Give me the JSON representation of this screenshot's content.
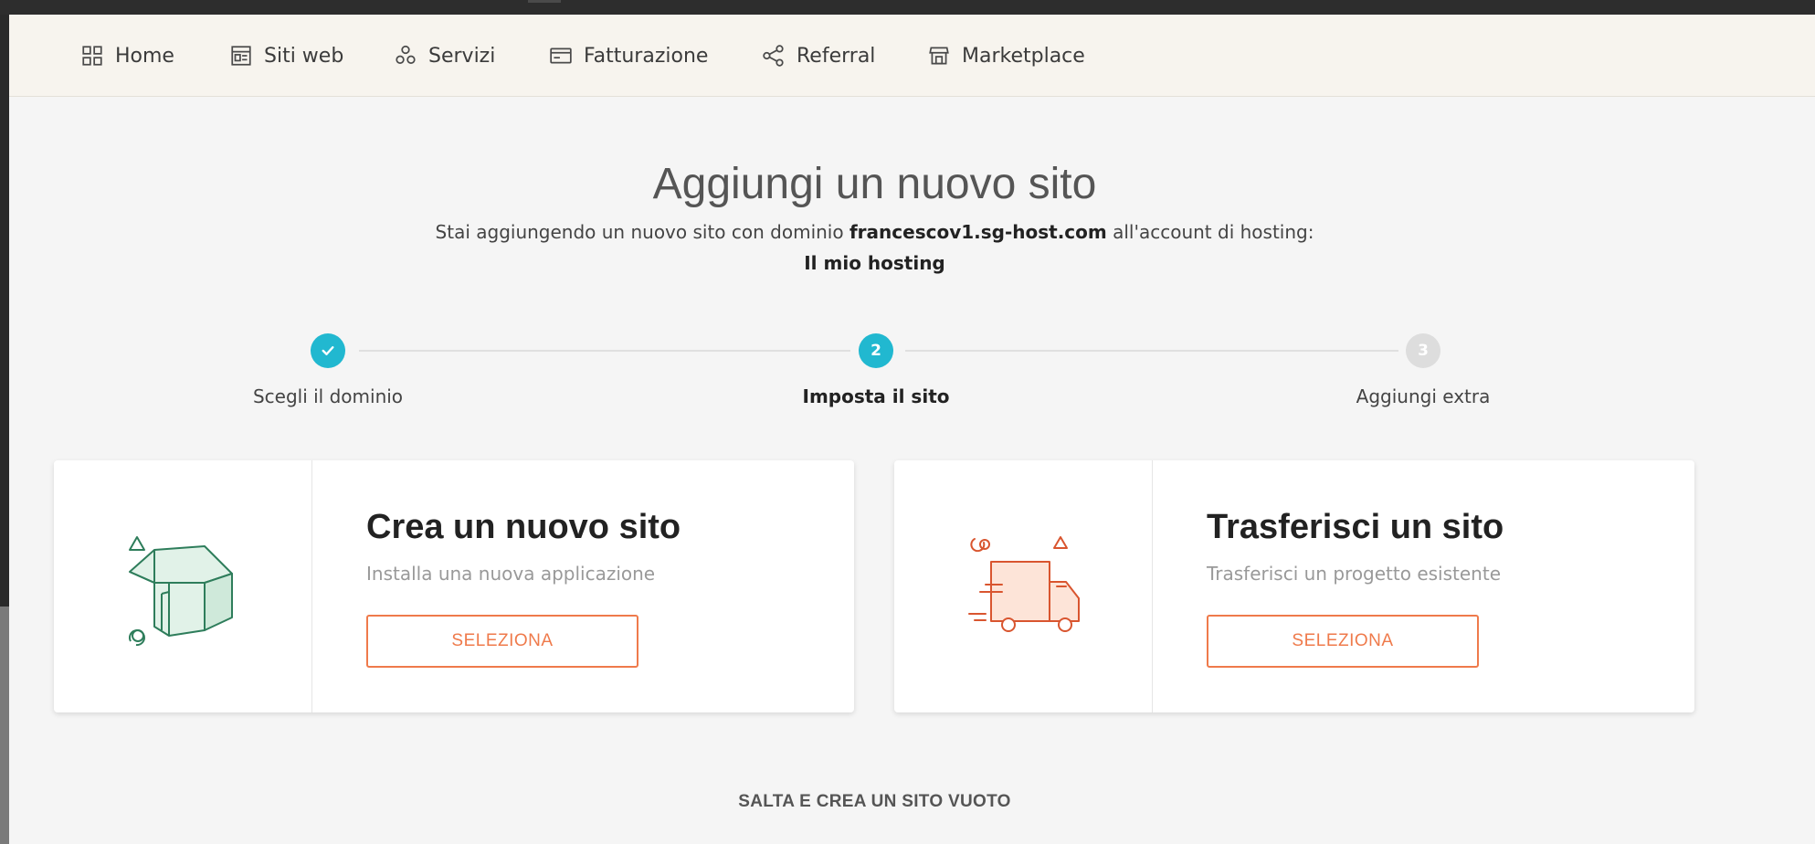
{
  "nav": {
    "items": [
      {
        "label": "Home",
        "icon": "grid-icon"
      },
      {
        "label": "Siti web",
        "icon": "website-icon"
      },
      {
        "label": "Servizi",
        "icon": "services-icon"
      },
      {
        "label": "Fatturazione",
        "icon": "billing-card-icon"
      },
      {
        "label": "Referral",
        "icon": "share-icon"
      },
      {
        "label": "Marketplace",
        "icon": "store-icon"
      }
    ]
  },
  "header": {
    "title": "Aggiungi un nuovo sito",
    "subtitle_prefix": "Stai aggiungendo un nuovo sito con dominio ",
    "domain": "francescov1.sg-host.com",
    "subtitle_suffix": " all'account di hosting:",
    "hosting_account": "Il mio hosting"
  },
  "stepper": {
    "steps": [
      {
        "number": "",
        "label": "Scegli il dominio",
        "state": "done"
      },
      {
        "number": "2",
        "label": "Imposta il sito",
        "state": "active"
      },
      {
        "number": "3",
        "label": "Aggiungi extra",
        "state": "pending"
      }
    ],
    "colors": {
      "done": "#21b8d0",
      "active": "#21b8d0",
      "pending": "#dddddd"
    }
  },
  "cards": [
    {
      "title": "Crea un nuovo sito",
      "description": "Installa una nuova applicazione",
      "button": "SELEZIONA",
      "icon": "house-box-icon"
    },
    {
      "title": "Trasferisci un sito",
      "description": "Trasferisci un progetto esistente",
      "button": "SELEZIONA",
      "icon": "delivery-truck-icon"
    }
  ],
  "skip": {
    "label": "SALTA E CREA UN SITO VUOTO"
  },
  "colors": {
    "accent": "#ef7a4b",
    "step": "#21b8d0",
    "navbar_bg": "#f7f4ee"
  }
}
